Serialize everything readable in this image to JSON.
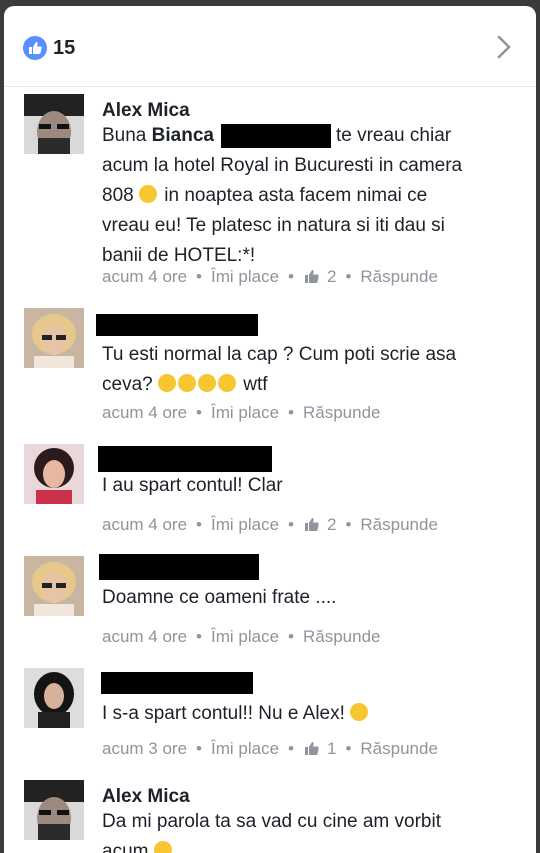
{
  "header": {
    "like_count": "15"
  },
  "comments": [
    {
      "author": "Alex Mica",
      "tagged": "Bianca",
      "text_a": "te vreau chiar",
      "text_b": "acum la hotel Royal in Bucuresti in camera",
      "text_c": "808",
      "text_d": "in noaptea asta facem nimai ce",
      "text_e": "vreau eu! Te platesc in natura si iti dau si",
      "text_f": "banii de HOTEL:*!",
      "time": "acum 4 ore",
      "like": "Îmi place",
      "likes": "2",
      "reply": "Răspunde"
    },
    {
      "author": "",
      "text_a": "Tu esti normal la cap ? Cum poti scrie asa",
      "text_b": "ceva?",
      "text_c": "wtf",
      "time": "acum 4 ore",
      "like": "Îmi place",
      "reply": "Răspunde"
    },
    {
      "author": "",
      "text_a": "I au spart contul! Clar",
      "time": "acum 4 ore",
      "like": "Îmi place",
      "likes": "2",
      "reply": "Răspunde"
    },
    {
      "author": "",
      "text_a": "Doamne ce oameni frate ....",
      "time": "acum 4 ore",
      "like": "Îmi place",
      "reply": "Răspunde"
    },
    {
      "author": "",
      "text_a": "I s-a spart contul!! Nu e Alex!",
      "time": "acum 3 ore",
      "like": "Îmi place",
      "likes": "1",
      "reply": "Răspunde"
    },
    {
      "author": "Alex Mica",
      "text_a": "Da mi parola ta sa vad cu cine am vorbit",
      "text_b": "acum"
    }
  ],
  "colors": {
    "link_blue": "#4267b2",
    "meta_gray": "#90949c",
    "text": "#1d2129",
    "like_badge": "#5890ff"
  }
}
